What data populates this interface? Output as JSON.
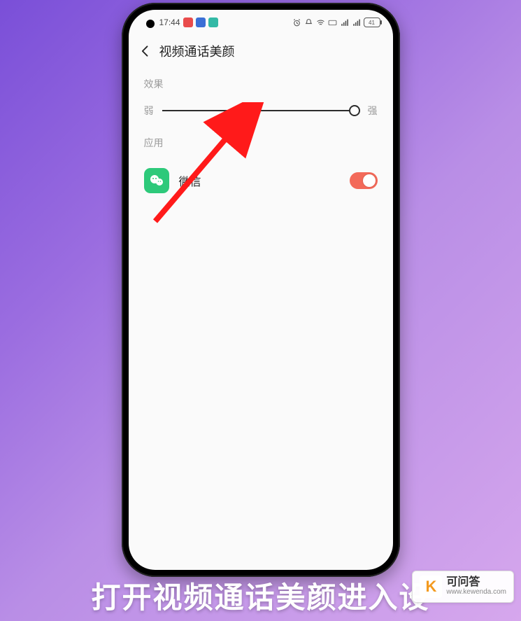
{
  "statusbar": {
    "time": "17:44",
    "battery_text": "41"
  },
  "header": {
    "title": "视频通话美颜"
  },
  "sections": {
    "effect_label": "效果",
    "apps_label": "应用"
  },
  "slider": {
    "min_label": "弱",
    "max_label": "强",
    "position_percent": 100
  },
  "apps": [
    {
      "name": "微信",
      "icon": "wechat-icon",
      "enabled": true
    }
  ],
  "caption_text": "打开视频通话美颜进入设",
  "watermark": {
    "logo_letter": "K",
    "title": "可问答",
    "url": "www.kewenda.com"
  },
  "colors": {
    "accent_toggle": "#f36a5a",
    "app_icon": "#2dc97a",
    "arrow": "#ff1a1a"
  }
}
